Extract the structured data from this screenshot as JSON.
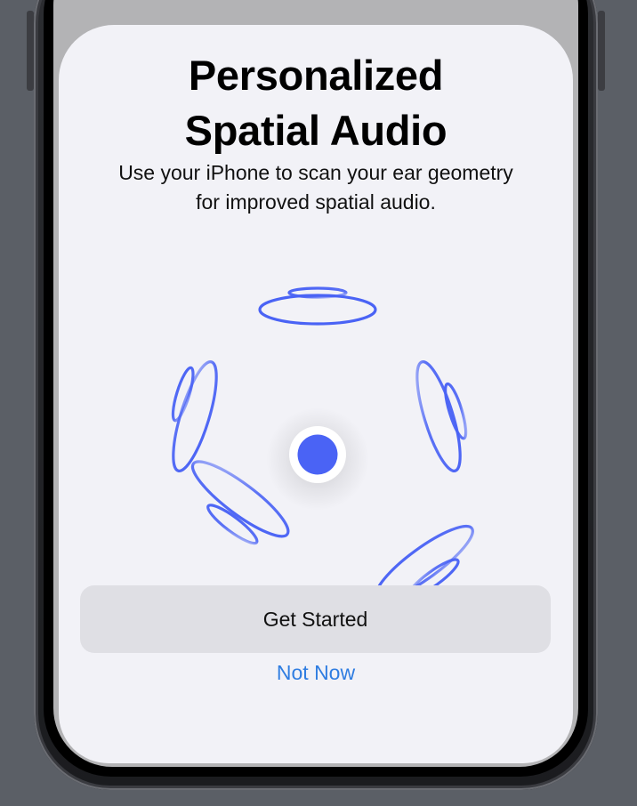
{
  "sheet": {
    "title_line1": "Personalized",
    "title_line2": "Spatial Audio",
    "subtitle_line1": "Use your iPhone to scan your ear geometry",
    "subtitle_line2": "for improved spatial audio.",
    "primary_button_label": "Get Started",
    "secondary_link_label": "Not Now"
  },
  "illustration": {
    "icon": "spatial-audio-rings-icon",
    "center_icon": "listener-dot-icon",
    "accent_color": "#4a63f5"
  },
  "colors": {
    "sheet_background": "#f2f2f7",
    "button_background": "#dfdfe4",
    "link_color": "#2f7de1"
  }
}
